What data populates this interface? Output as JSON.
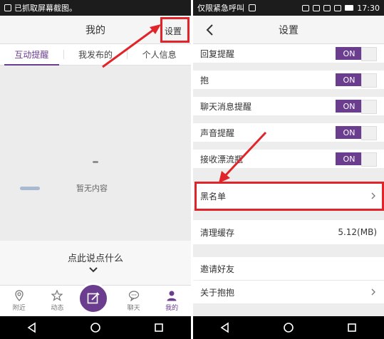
{
  "left": {
    "status_text": "已抓取屏幕截图。",
    "title": "我的",
    "settings_label": "设置",
    "tabs": [
      "互动提醒",
      "我发布的",
      "个人信息"
    ],
    "empty_text": "暂无内容",
    "prompt_text": "点此说点什么",
    "bottom_tabs": [
      {
        "label": "附近",
        "icon": "location-pin-icon"
      },
      {
        "label": "动态",
        "icon": "star-icon"
      },
      {
        "label": "",
        "icon": "compose-icon"
      },
      {
        "label": "聊天",
        "icon": "chat-bubble-icon"
      },
      {
        "label": "我的",
        "icon": "person-icon"
      }
    ]
  },
  "right": {
    "status_text": "仅限紧急呼叫",
    "time": "17:30",
    "title": "设置",
    "rows": [
      {
        "label": "回复提醒",
        "toggle": "ON"
      },
      {
        "label": "抱",
        "toggle": "ON"
      },
      {
        "label": "聊天消息提醒",
        "toggle": "ON"
      },
      {
        "label": "声音提醒",
        "toggle": "ON"
      },
      {
        "label": "接收漂流瓶",
        "toggle": "ON"
      },
      {
        "label": "黑名单"
      },
      {
        "label": "清理缓存",
        "value": "5.12(MB)"
      },
      {
        "label": "邀请好友"
      },
      {
        "label": "关于抱抱"
      }
    ]
  },
  "colors": {
    "accent": "#6a3d8f",
    "highlight": "#e0242a"
  }
}
